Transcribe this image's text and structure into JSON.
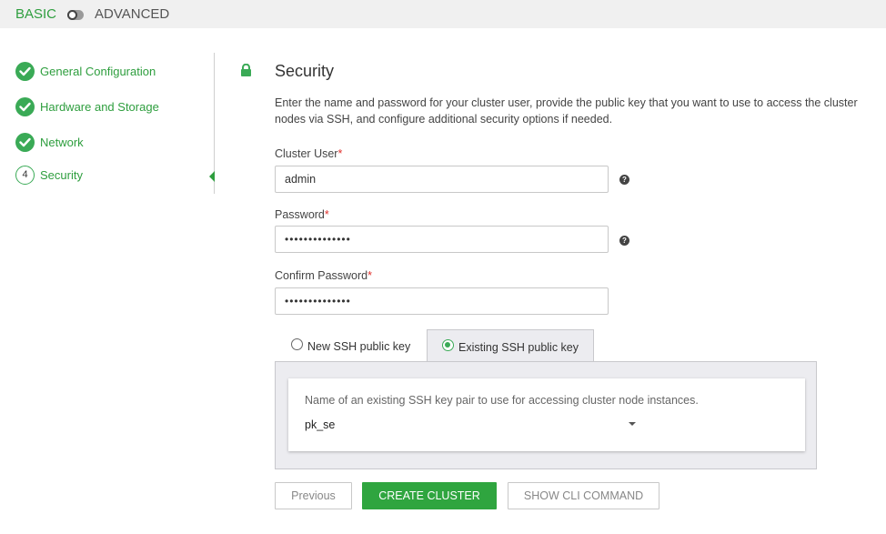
{
  "mode": {
    "basic": "BASIC",
    "advanced": "ADVANCED"
  },
  "steps": [
    {
      "label": "General Configuration",
      "state": "complete"
    },
    {
      "label": "Hardware and Storage",
      "state": "complete"
    },
    {
      "label": "Network",
      "state": "complete"
    },
    {
      "label": "Security",
      "state": "active",
      "number": "4"
    }
  ],
  "section": {
    "title": "Security",
    "description": "Enter the name and password for your cluster user, provide the public key that you want to use to access the cluster nodes via SSH, and configure additional security options if needed."
  },
  "fields": {
    "cluster_user": {
      "label": "Cluster User",
      "required": "*",
      "value": "admin",
      "help": "?"
    },
    "password": {
      "label": "Password",
      "required": "*",
      "value": "••••••••••••••",
      "help": "?"
    },
    "confirm_password": {
      "label": "Confirm Password",
      "required": "*",
      "value": "••••••••••••••"
    }
  },
  "ssh_tabs": {
    "new": {
      "label": "New SSH public key",
      "selected": false
    },
    "existing": {
      "label": "Existing SSH public key",
      "selected": true
    }
  },
  "ssh_panel": {
    "hint": "Name of an existing SSH key pair to use for accessing cluster node instances.",
    "selected_key": "pk_se"
  },
  "buttons": {
    "previous": "Previous",
    "create": "CREATE CLUSTER",
    "cli": "SHOW CLI COMMAND"
  },
  "colors": {
    "accent": "#2fa53f",
    "required": "#e0302c"
  }
}
